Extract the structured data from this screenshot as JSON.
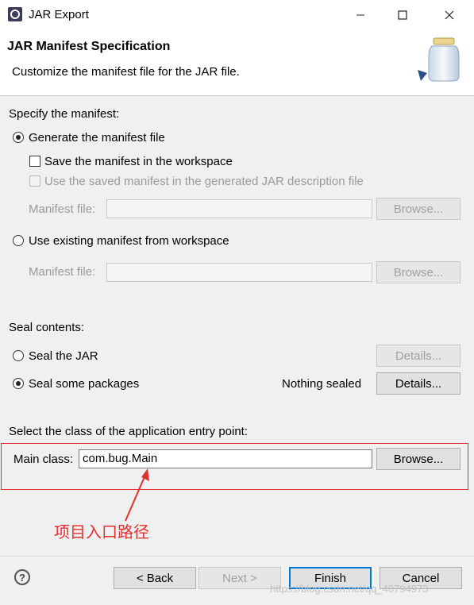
{
  "window": {
    "title": "JAR Export"
  },
  "header": {
    "title": "JAR Manifest Specification",
    "description": "Customize the manifest file for the JAR file."
  },
  "manifest": {
    "section_label": "Specify the manifest:",
    "generate_label": "Generate the manifest file",
    "save_in_workspace_label": "Save the manifest in the workspace",
    "use_saved_label": "Use the saved manifest in the generated JAR description file",
    "manifest_file_label": "Manifest file:",
    "browse_label": "Browse...",
    "use_existing_label": "Use existing manifest from workspace",
    "manifest_file_label_2": "Manifest file:",
    "browse_label_2": "Browse..."
  },
  "seal": {
    "section_label": "Seal contents:",
    "seal_jar_label": "Seal the JAR",
    "details_label_1": "Details...",
    "seal_packages_label": "Seal some packages",
    "status_text": "Nothing sealed",
    "details_label_2": "Details..."
  },
  "entry": {
    "section_label": "Select the class of the application entry point:",
    "main_class_label": "Main class:",
    "main_class_value": "com.bug.Main",
    "browse_label": "Browse..."
  },
  "annotation": {
    "text": "项目入口路径"
  },
  "footer": {
    "back_label": "< Back",
    "next_label": "Next >",
    "finish_label": "Finish",
    "cancel_label": "Cancel"
  },
  "watermark": "https://blog.csdn.net/qq_40794973",
  "colors": {
    "annotation": "#e0312f",
    "default_button_border": "#0078d7"
  }
}
